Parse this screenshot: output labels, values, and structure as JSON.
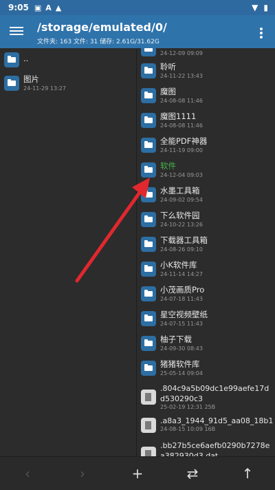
{
  "status": {
    "time": "9:05",
    "icons": [
      "notification-icon",
      "a-icon",
      "alert-icon"
    ],
    "right": [
      "wifi-icon",
      "battery-icon"
    ]
  },
  "appbar": {
    "path": "/storage/emulated/0/",
    "stats": "文件夹: 163  文件: 31  储存: 2.61G/31.62G"
  },
  "left": {
    "items": [
      {
        "name": "..",
        "date": ""
      },
      {
        "name": "图片",
        "date": "24-11-29 13:27"
      }
    ]
  },
  "right": {
    "top_partial_date": "24-12-09 09:09",
    "folders": [
      {
        "name": "聆听",
        "date": "24-11-22 13:43"
      },
      {
        "name": "魔图",
        "date": "24-08-08 11:46"
      },
      {
        "name": "魔图1111",
        "date": "24-08-08 11:46"
      },
      {
        "name": "全能PDF神器",
        "date": "24-11-19 09:00"
      },
      {
        "name": "软件",
        "date": "24-12-04 09:03"
      },
      {
        "name": "水墨工具箱",
        "date": "24-09-02 09:54"
      },
      {
        "name": "下么软件园",
        "date": "24-10-22 13:26"
      },
      {
        "name": "下载器工具箱",
        "date": "24-08-26 09:10"
      },
      {
        "name": "小K软件库",
        "date": "24-11-14 14:27"
      },
      {
        "name": "小茂画质Pro",
        "date": "24-07-18 11:43"
      },
      {
        "name": "星空视频壁纸",
        "date": "24-07-15 11:43"
      },
      {
        "name": "柚子下载",
        "date": "24-09-30 08:43"
      },
      {
        "name": "猪猪软件库",
        "date": "25-05-14 09:04"
      }
    ],
    "files": [
      {
        "name": ".804c9a5b09dc1e99aefe17dd530290c3",
        "meta": "25-02-19 12:31  25B"
      },
      {
        "name": ".a8a3_1944_91d5_aa08_18b1",
        "meta": "24-08-15 10:09  16B"
      },
      {
        "name": ".bb27b5ce6aefb0290b7278ea382930d3.dat",
        "meta": ""
      }
    ]
  },
  "bottombar": {
    "back": "‹",
    "forward": "›",
    "add": "+",
    "swap": "⇄",
    "up": "↑"
  },
  "colors": {
    "appbar": "#2f73ab",
    "highlight": "#47b34a",
    "annotation_arrow": "#e0282e"
  }
}
